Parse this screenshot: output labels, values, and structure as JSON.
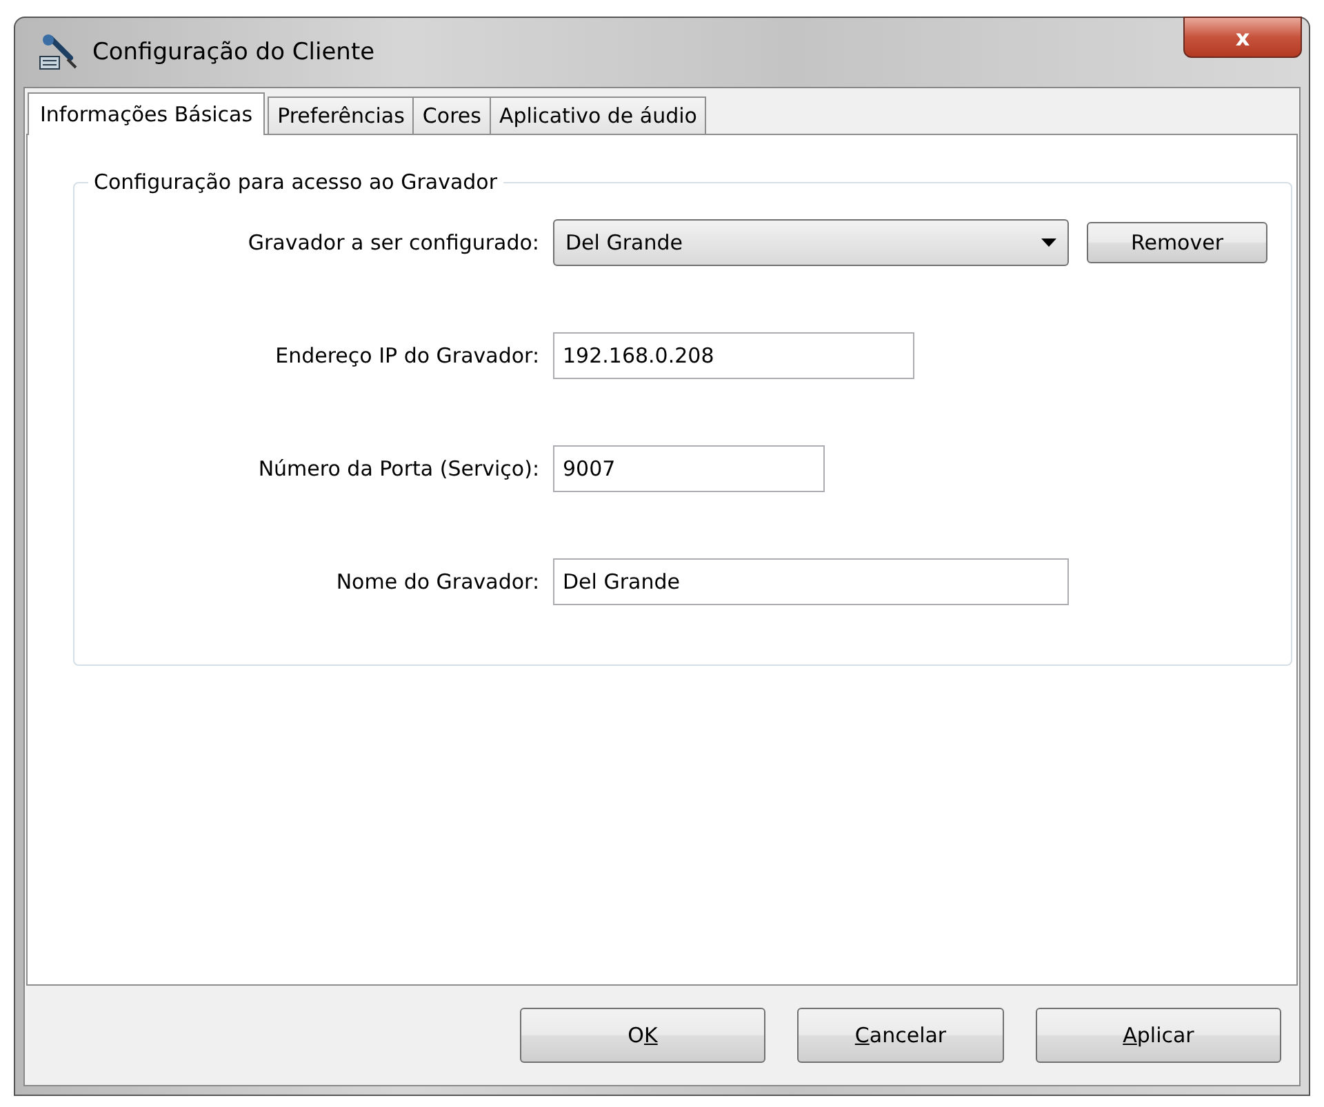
{
  "window": {
    "title": "Configuração do Cliente",
    "close": "x"
  },
  "tabs": [
    {
      "label": "Informações Básicas",
      "selected": true
    },
    {
      "label": "Preferências",
      "selected": false
    },
    {
      "label": "Cores",
      "selected": false
    },
    {
      "label": "Aplicativo de áudio",
      "selected": false
    }
  ],
  "group": {
    "title": "Configuração para acesso ao Gravador",
    "rows": [
      {
        "kind": "dropdown",
        "label": "Gravador a ser configurado:",
        "value": "Del Grande",
        "button": "Remover"
      },
      {
        "kind": "text",
        "label": "Endereço IP do Gravador:",
        "value": "192.168.0.208"
      },
      {
        "kind": "text",
        "label": "Número da Porta (Serviço):",
        "value": "9007"
      },
      {
        "kind": "text",
        "label": "Nome do Gravador:",
        "value": "Del Grande"
      }
    ]
  },
  "buttons": [
    {
      "before": "O",
      "access_key": "K"
    },
    {
      "access_key": "C",
      "after": "ancelar"
    },
    {
      "access_key": "A",
      "after": "plicar"
    }
  ]
}
